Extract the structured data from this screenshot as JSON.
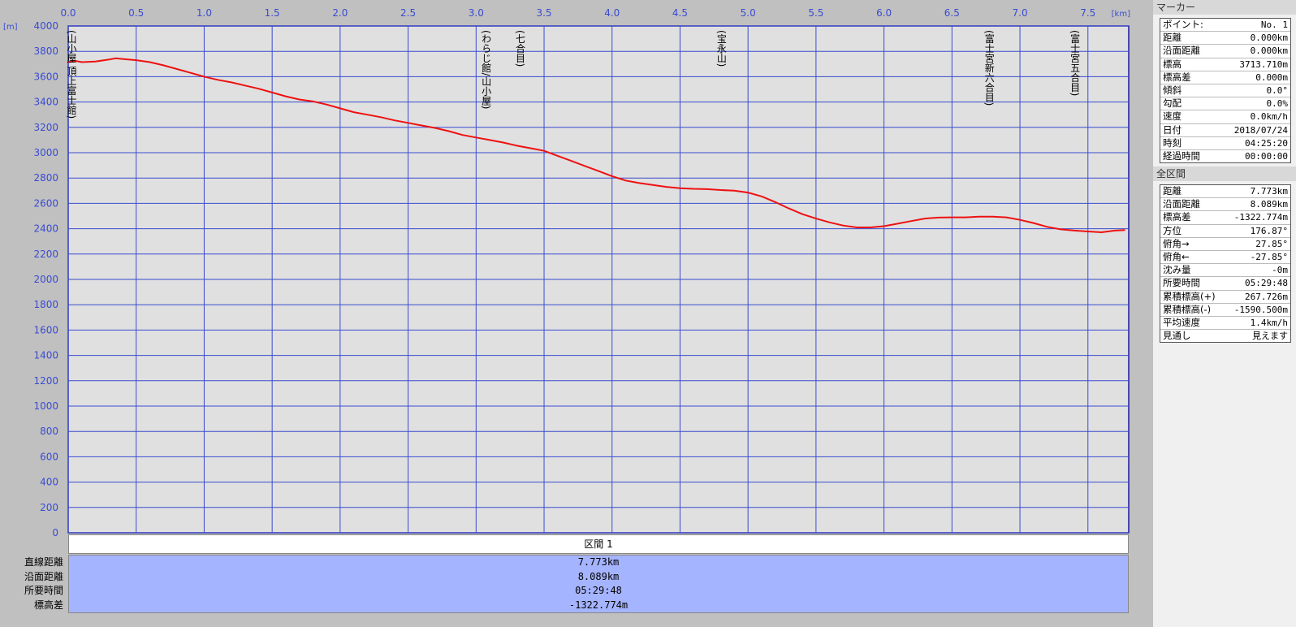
{
  "chart_data": {
    "type": "line",
    "x_unit": "[km]",
    "y_unit": "[m]",
    "xlim": [
      0.0,
      7.8
    ],
    "ylim": [
      0,
      4000
    ],
    "x_ticks": [
      "0.0",
      "0.5",
      "1.0",
      "1.5",
      "2.0",
      "2.5",
      "3.0",
      "3.5",
      "4.0",
      "4.5",
      "5.0",
      "5.5",
      "6.0",
      "6.5",
      "7.0",
      "7.5"
    ],
    "y_ticks": [
      "0",
      "200",
      "400",
      "600",
      "800",
      "1000",
      "1200",
      "1400",
      "1600",
      "1800",
      "2000",
      "2200",
      "2400",
      "2600",
      "2800",
      "3000",
      "3200",
      "3400",
      "3600",
      "3800",
      "4000"
    ],
    "grid": true,
    "color": "#ee1111",
    "series": [
      {
        "x": [
          0.0,
          0.05,
          0.1,
          0.2,
          0.3,
          0.35,
          0.4,
          0.5,
          0.6,
          0.7,
          0.8,
          0.9,
          1.0,
          1.1,
          1.2,
          1.3,
          1.4,
          1.5,
          1.6,
          1.7,
          1.8,
          1.9,
          2.0,
          2.1,
          2.2,
          2.3,
          2.4,
          2.5,
          2.6,
          2.7,
          2.8,
          2.9,
          3.0,
          3.1,
          3.2,
          3.3,
          3.4,
          3.5,
          3.6,
          3.7,
          3.8,
          3.9,
          4.0,
          4.1,
          4.2,
          4.3,
          4.4,
          4.5,
          4.6,
          4.7,
          4.8,
          4.9,
          5.0,
          5.1,
          5.2,
          5.3,
          5.4,
          5.5,
          5.6,
          5.7,
          5.8,
          5.9,
          6.0,
          6.1,
          6.2,
          6.3,
          6.4,
          6.5,
          6.6,
          6.7,
          6.8,
          6.9,
          7.0,
          7.1,
          7.2,
          7.3,
          7.4,
          7.5,
          7.6,
          7.7,
          7.773
        ],
        "values": [
          3714,
          3725,
          3715,
          3720,
          3735,
          3745,
          3740,
          3730,
          3715,
          3690,
          3660,
          3630,
          3600,
          3575,
          3555,
          3530,
          3505,
          3475,
          3445,
          3420,
          3405,
          3380,
          3350,
          3320,
          3300,
          3280,
          3255,
          3235,
          3215,
          3195,
          3170,
          3140,
          3120,
          3100,
          3080,
          3055,
          3035,
          3015,
          2975,
          2935,
          2895,
          2855,
          2815,
          2780,
          2760,
          2745,
          2730,
          2720,
          2715,
          2712,
          2705,
          2700,
          2685,
          2655,
          2610,
          2560,
          2515,
          2480,
          2450,
          2425,
          2410,
          2410,
          2420,
          2440,
          2460,
          2480,
          2488,
          2490,
          2490,
          2495,
          2495,
          2490,
          2470,
          2445,
          2415,
          2395,
          2385,
          2378,
          2372,
          2385,
          2390
        ]
      }
    ],
    "waypoints": [
      {
        "x": 0.0,
        "label": "(山小屋 頂上富士館)"
      },
      {
        "x": 3.05,
        "label": "(わらじ館/山小屋)"
      },
      {
        "x": 3.3,
        "label": "(七合目)"
      },
      {
        "x": 4.78,
        "label": "(宝永山)"
      },
      {
        "x": 6.75,
        "label": "(富士宮新六合目)"
      },
      {
        "x": 7.38,
        "label": "(富士宮五合目)"
      }
    ]
  },
  "section": {
    "header": "区間 1",
    "rows": [
      {
        "label": "直線距離",
        "value": "7.773km"
      },
      {
        "label": "沿面距離",
        "value": "8.089km"
      },
      {
        "label": "所要時間",
        "value": "05:29:48"
      },
      {
        "label": "標高差",
        "value": "-1322.774m"
      }
    ]
  },
  "marker_panel": {
    "title": "マーカー",
    "items": [
      {
        "k": "ポイント:",
        "v": "No. 1"
      },
      {
        "k": "距離",
        "v": "0.000km"
      },
      {
        "k": "沿面距離",
        "v": "0.000km"
      },
      {
        "k": "標高",
        "v": "3713.710m"
      },
      {
        "k": "標高差",
        "v": "0.000m"
      },
      {
        "k": "傾斜",
        "v": "0.0°"
      },
      {
        "k": "勾配",
        "v": "0.0%"
      },
      {
        "k": "速度",
        "v": "0.0km/h"
      },
      {
        "k": "日付",
        "v": "2018/07/24"
      },
      {
        "k": "時刻",
        "v": "04:25:20"
      },
      {
        "k": "経過時間",
        "v": "00:00:00"
      }
    ]
  },
  "total_panel": {
    "title": "全区間",
    "items": [
      {
        "k": "距離",
        "v": "7.773km"
      },
      {
        "k": "沿面距離",
        "v": "8.089km"
      },
      {
        "k": "標高差",
        "v": "-1322.774m"
      },
      {
        "k": "方位",
        "v": "176.87°"
      },
      {
        "k": "俯角→",
        "v": "27.85°"
      },
      {
        "k": "俯角←",
        "v": "-27.85°"
      },
      {
        "k": "沈み量",
        "v": "-0m"
      },
      {
        "k": "所要時間",
        "v": "05:29:48"
      },
      {
        "k": "累積標高(+)",
        "v": "267.726m"
      },
      {
        "k": "累積標高(-)",
        "v": "-1590.500m"
      },
      {
        "k": "平均速度",
        "v": "1.4km/h"
      },
      {
        "k": "見通し",
        "v": "見えます"
      }
    ]
  }
}
